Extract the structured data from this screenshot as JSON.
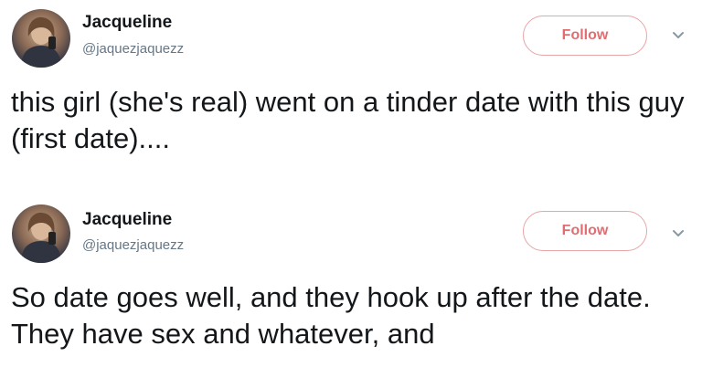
{
  "tweets": [
    {
      "user_name": "Jacqueline",
      "user_handle": "@jaquezjaquezz",
      "follow_label": "Follow",
      "text": "this girl (she's real) went on a tinder date with this guy (first date)....",
      "avatar_icon": "profile-photo",
      "caret_icon": "chevron-down-icon"
    },
    {
      "user_name": "Jacqueline",
      "user_handle": "@jaquezjaquezz",
      "follow_label": "Follow",
      "text": "So date goes well, and they hook up after the date. They have sex and whatever, and",
      "avatar_icon": "profile-photo",
      "caret_icon": "chevron-down-icon"
    }
  ],
  "colors": {
    "follow_accent": "#e06d72",
    "follow_border": "#e8a4a6",
    "handle_gray": "#657786",
    "text_dark": "#14171a"
  }
}
